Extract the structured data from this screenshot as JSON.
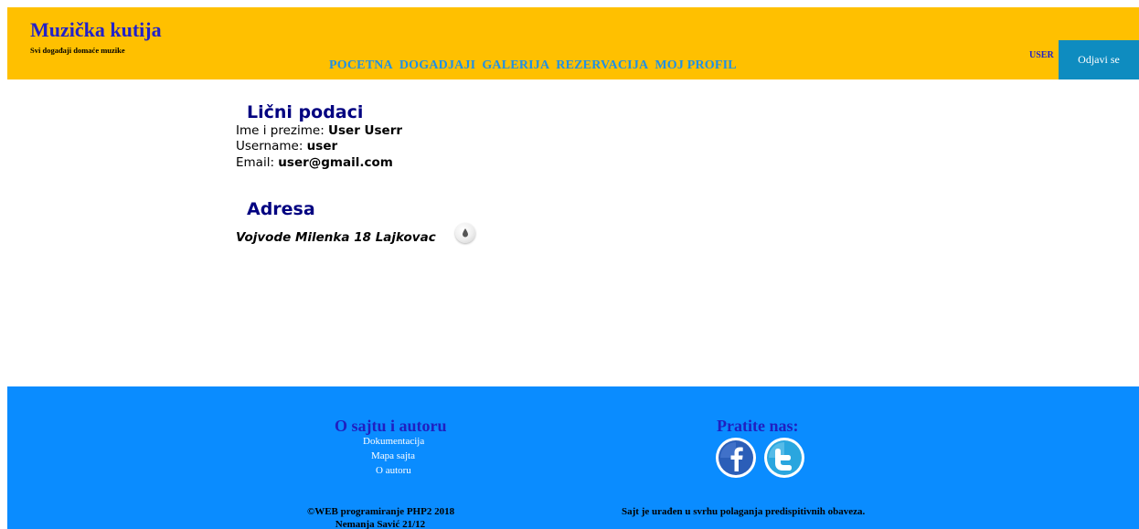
{
  "header": {
    "site_title": "Muzička kutija",
    "site_subtitle": "Svi događaji domaće muzike",
    "nav": [
      "POCETNA",
      "DOGADJAJI",
      "GALERIJA",
      "REZERVACIJA",
      "MOJ PROFIL"
    ],
    "user_label": "USER",
    "logout_label": "Odjavi se",
    "colors": {
      "background": "#ffc000",
      "nav_link": "#1e90e6",
      "logout_button": "#0e8cc0"
    }
  },
  "profile": {
    "personal_title": "Lični podaci",
    "full_name_label": "Ime i prezime: ",
    "full_name": "User Userr",
    "username_label": "Username: ",
    "username": "user",
    "email_label": "Email: ",
    "email": "user@gmail.com",
    "address_title": "Adresa",
    "address": "Vojvode Milenka 18 Lajkovac",
    "map_icon": "map-pin-icon"
  },
  "footer": {
    "about_heading": "O sajtu i autoru",
    "links": [
      "Dokumentacija",
      "Mapa sajta",
      "O autoru"
    ],
    "follow_heading": "Pratite nas:",
    "social": [
      "facebook-icon",
      "twitter-icon"
    ],
    "copyright": "©WEB programiranje PHP2 2018",
    "author": "Nemanja Savić 21/12",
    "note": "Sajt je urađen u svrhu polaganja predispitivnih obaveza.",
    "colors": {
      "background": "#0a8cff",
      "heading": "#2020c0"
    }
  }
}
